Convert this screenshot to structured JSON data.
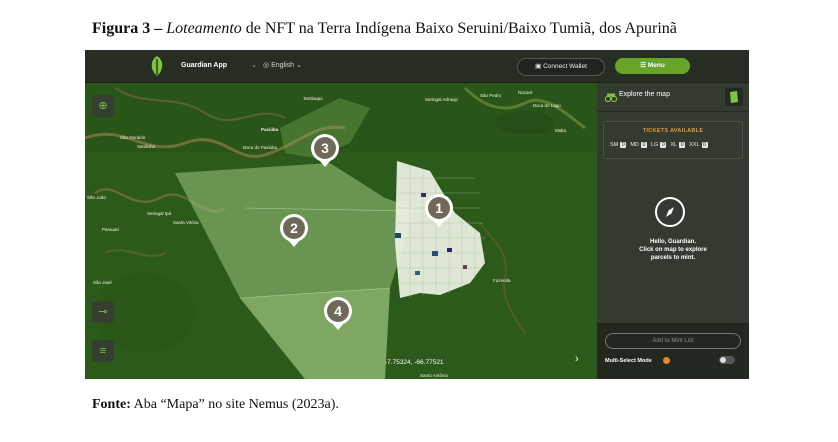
{
  "figure": {
    "label": "Figura 3 –",
    "title_italic": "Loteamento",
    "title_rest": "de NFT na Terra Indígena Baixo Seruini/Baixo Tumiã, dos Apurinã"
  },
  "source": {
    "label": "Fonte:",
    "text": "Aba “Mapa” no site Nemus (2023a)."
  },
  "header": {
    "app_select": "Guardian App",
    "language": "English",
    "connect_wallet": "Connect Wallet",
    "menu": "Menu"
  },
  "panel": {
    "tab_label": "Explore the map",
    "tickets_title": "TICKETS AVAILABLE",
    "tickets": [
      {
        "size": "SM",
        "count": "0"
      },
      {
        "size": "MD",
        "count": "0"
      },
      {
        "size": "LG",
        "count": "0"
      },
      {
        "size": "XL",
        "count": "0"
      },
      {
        "size": "XXL",
        "count": "0"
      }
    ],
    "hello_line1": "Hello, Guardian.",
    "hello_line2": "Click on map to explore",
    "hello_line3": "parcels to mint.",
    "mint_button": "Add to Mint List",
    "multi_select": "Multi-Select Mode"
  },
  "map": {
    "coords": "-7.75324, -66.77521",
    "pins": [
      "3",
      "1",
      "2",
      "4"
    ],
    "labels": {
      "sao_geraldo": "São Geraldo",
      "sardinha": "Sardinha",
      "paxiuba": "Paxiúba",
      "boca_paxiuba": "Boca do Paxiúba",
      "seringal_ipa": "Seringal Ipá",
      "sao_joao": "São João",
      "santa_vitoria": "Santa Vitória",
      "parauari": "Parauari",
      "sao_jose": "São José",
      "santo_antonio": "Santo Antônio",
      "tambaqui": "Tambaqui",
      "boca_do_lago": "Boca do Lago",
      "seringal_adraujo": "Seringal Adraujo",
      "sao_pedro": "São Pedro",
      "nazare": "Nazaré",
      "fazenda": "Fazenda",
      "malta": "Malta"
    }
  }
}
